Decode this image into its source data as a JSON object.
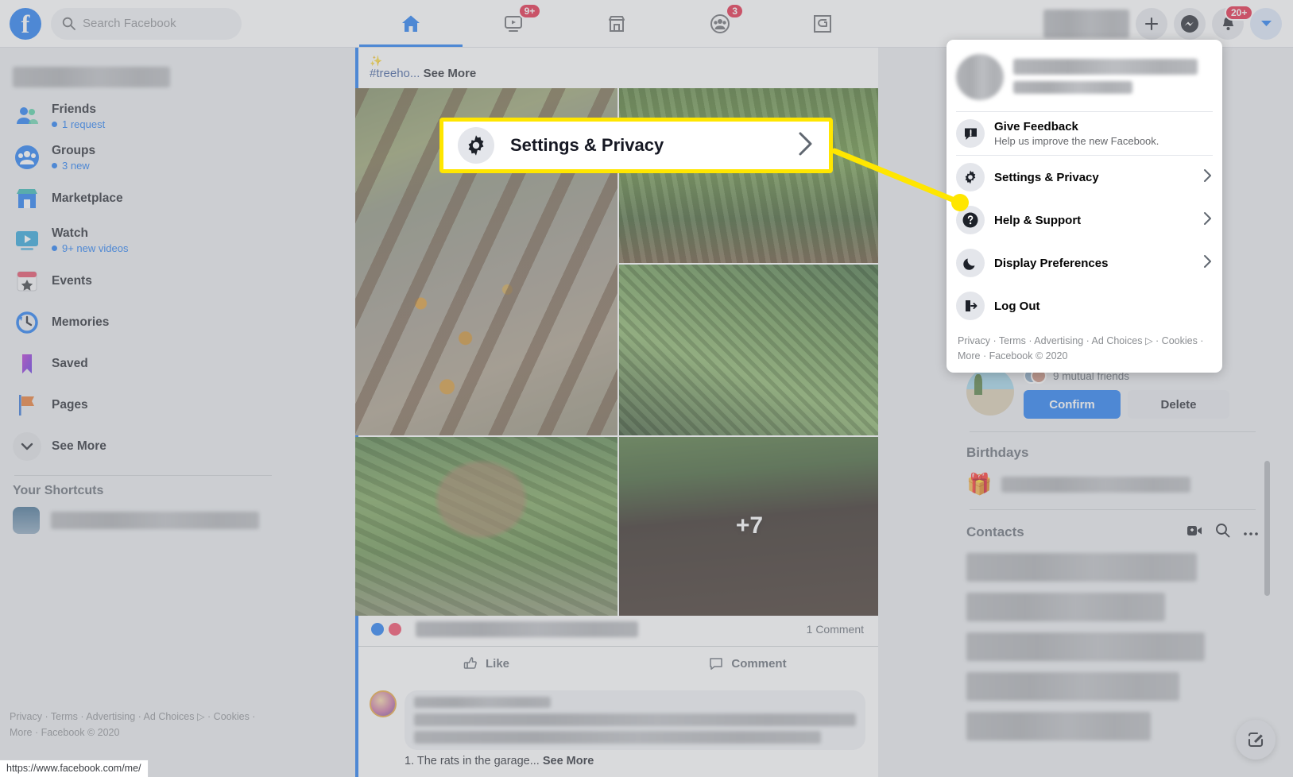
{
  "topbar": {
    "logo_letter": "f",
    "search_placeholder": "Search Facebook",
    "search_value": "",
    "nav_tabs": [
      {
        "name": "home",
        "badge": "",
        "active": true
      },
      {
        "name": "watch",
        "badge": "9+",
        "active": false
      },
      {
        "name": "marketplace",
        "badge": "",
        "active": false
      },
      {
        "name": "groups",
        "badge": "3",
        "active": false
      },
      {
        "name": "gaming",
        "badge": "",
        "active": false
      }
    ],
    "notifications_badge": "20+"
  },
  "sidebar": {
    "items": [
      {
        "label": "Friends",
        "sub": "1 request",
        "icon": "friends-icon"
      },
      {
        "label": "Groups",
        "sub": "3 new",
        "icon": "groups-icon"
      },
      {
        "label": "Marketplace",
        "sub": "",
        "icon": "marketplace-icon"
      },
      {
        "label": "Watch",
        "sub": "9+ new videos",
        "icon": "watch-icon"
      },
      {
        "label": "Events",
        "sub": "",
        "icon": "events-icon"
      },
      {
        "label": "Memories",
        "sub": "",
        "icon": "memories-icon"
      },
      {
        "label": "Saved",
        "sub": "",
        "icon": "saved-icon"
      },
      {
        "label": "Pages",
        "sub": "",
        "icon": "pages-icon"
      },
      {
        "label": "See More",
        "sub": "",
        "icon": "chevron-down-icon"
      }
    ],
    "shortcuts_title": "Your Shortcuts",
    "footer": "Privacy · Terms · Advertising · Ad Choices ▷ · Cookies · More · Facebook © 2020"
  },
  "statusbar": {
    "url": "https://www.facebook.com/me/"
  },
  "feed": {
    "post": {
      "text_hashtag": "#treeho...",
      "text_seemore": "See More",
      "photo_overflow": "+7",
      "comment_count": "1 Comment",
      "like_label": "Like",
      "comment_label": "Comment"
    },
    "comment": {
      "text": "1. The rats in the garage...",
      "seemore": "See More"
    }
  },
  "rail": {
    "mutual_friends": "9 mutual friends",
    "confirm_label": "Confirm",
    "delete_label": "Delete",
    "birthdays_title": "Birthdays",
    "contacts_title": "Contacts"
  },
  "dropdown": {
    "items": [
      {
        "label": "Give Feedback",
        "desc": "Help us improve the new Facebook.",
        "icon": "feedback-icon",
        "chevron": false
      },
      {
        "label": "Settings & Privacy",
        "desc": "",
        "icon": "gear-icon",
        "chevron": true
      },
      {
        "label": "Help & Support",
        "desc": "",
        "icon": "question-icon",
        "chevron": true
      },
      {
        "label": "Display Preferences",
        "desc": "",
        "icon": "moon-icon",
        "chevron": true
      },
      {
        "label": "Log Out",
        "desc": "",
        "icon": "logout-icon",
        "chevron": false
      }
    ],
    "footer": "Privacy · Terms · Advertising · Ad Choices ▷ · Cookies · More · Facebook © 2020"
  },
  "callout": {
    "label": "Settings & Privacy",
    "icon": "gear-icon",
    "highlight_color": "#ffe600"
  }
}
